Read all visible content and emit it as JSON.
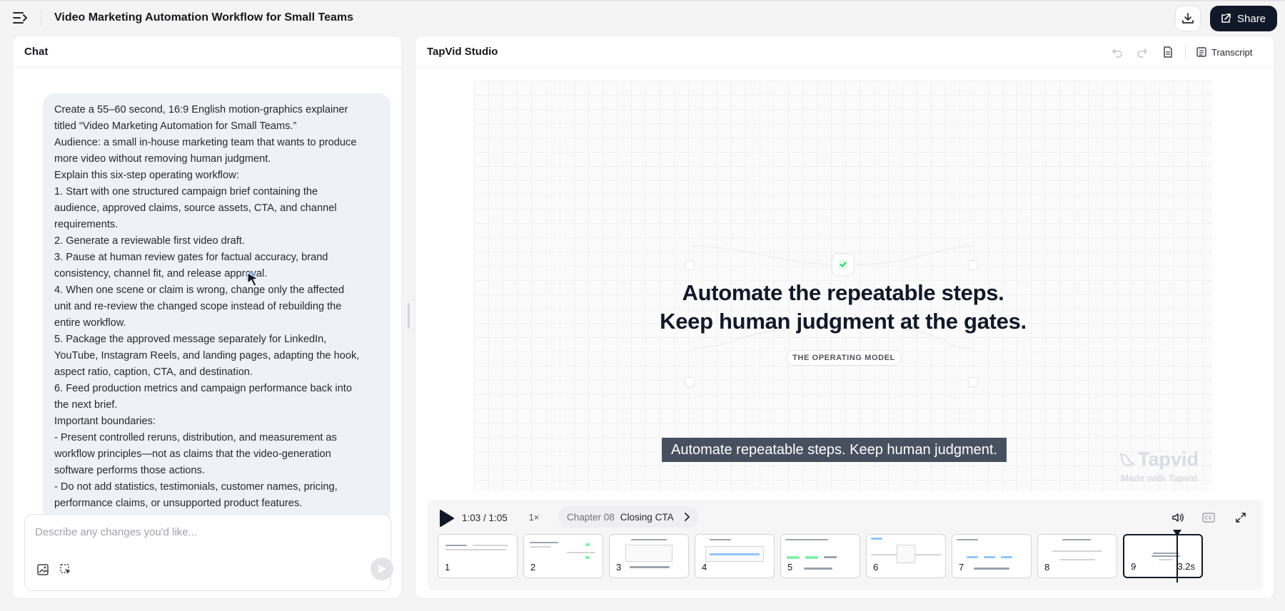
{
  "header": {
    "title": "Video Marketing Automation Workflow for Small Teams",
    "share_label": "Share",
    "icons": {
      "menu": "sidebar-toggle-icon",
      "download": "download-icon",
      "share": "share-icon"
    }
  },
  "chat": {
    "title": "Chat",
    "message_lines": [
      "Create a 55–60 second, 16:9 English motion-graphics explainer",
      "titled “Video Marketing Automation for Small Teams.”",
      "Audience: a small in-house marketing team that wants to produce",
      "more video without removing human judgment.",
      "Explain this six-step operating workflow:",
      "1. Start with one structured campaign brief containing the",
      "audience, approved claims, source assets, CTA, and channel",
      "requirements.",
      "2. Generate a reviewable first video draft.",
      "3. Pause at human review gates for factual accuracy, brand",
      "consistency, channel fit, and release approval.",
      "4. When one scene or claim is wrong, change only the affected",
      "unit and re-review the changed scope instead of rebuilding the",
      "entire workflow.",
      "5. Package the approved message separately for LinkedIn,",
      "YouTube, Instagram Reels, and landing pages, adapting the hook,",
      "aspect ratio, caption, CTA, and destination.",
      "6. Feed production metrics and campaign performance back into",
      "the next brief.",
      "Important boundaries:",
      "- Present controlled reruns, distribution, and measurement as",
      "workflow principles—not as claims that the video-generation",
      "software performs those actions.",
      "- Do not add statistics, testimonials, customer names, pricing,",
      "performance claims, or unsupported product features."
    ],
    "input": {
      "value": "",
      "placeholder": "Describe any changes you'd like..."
    }
  },
  "studio": {
    "title": "TapVid Studio",
    "transcript_label": "Transcript",
    "preview": {
      "headline_line1": "Automate the repeatable steps.",
      "headline_line2": "Keep human judgment at the gates.",
      "tag": "THE OPERATING MODEL",
      "caption": "Automate repeatable steps. Keep human judgment.",
      "watermark_name": "Tapvid",
      "watermark_sub": "Made with Tapvid"
    },
    "player": {
      "time": "1:03 / 1:05",
      "speed": "1×",
      "chapter_number": "Chapter 08",
      "chapter_name": "Closing CTA"
    },
    "scenes": [
      {
        "number": "1",
        "duration": ""
      },
      {
        "number": "2",
        "duration": ""
      },
      {
        "number": "3",
        "duration": ""
      },
      {
        "number": "4",
        "duration": ""
      },
      {
        "number": "5",
        "duration": ""
      },
      {
        "number": "6",
        "duration": ""
      },
      {
        "number": "7",
        "duration": ""
      },
      {
        "number": "8",
        "duration": ""
      },
      {
        "number": "9",
        "duration": "3.2s"
      }
    ],
    "active_scene": "9"
  },
  "colors": {
    "accent": "#111827",
    "caption_bg": "#374151",
    "check": "#22c55e"
  }
}
